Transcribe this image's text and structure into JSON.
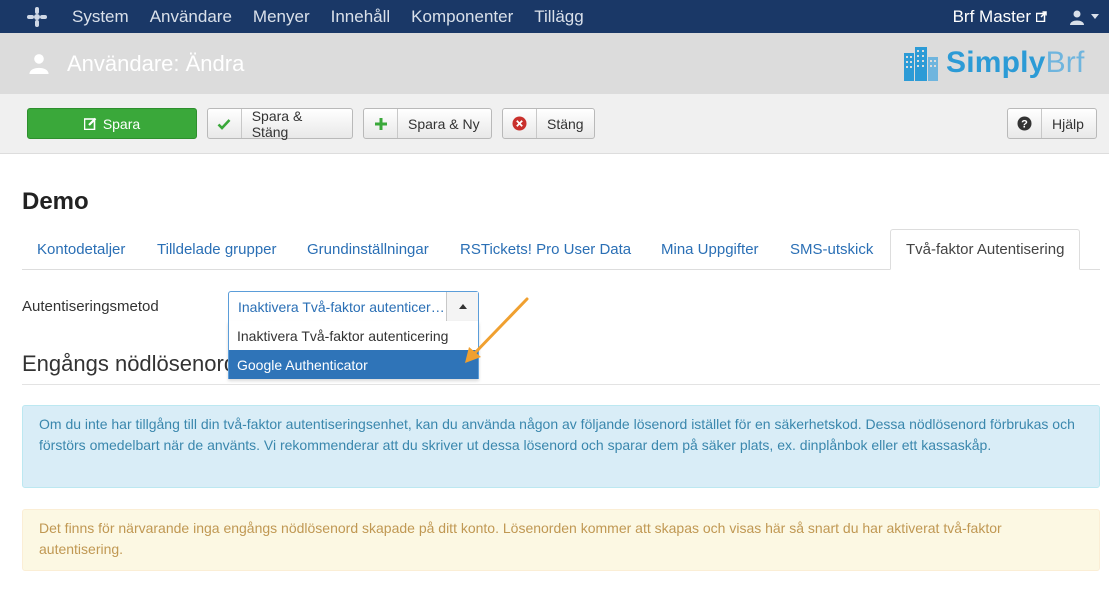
{
  "topnav": {
    "items": [
      "System",
      "Användare",
      "Menyer",
      "Innehåll",
      "Komponenter",
      "Tillägg"
    ],
    "site_name": "Brf Master"
  },
  "header": {
    "title": "Användare: Ändra",
    "brand_part1": "Simply",
    "brand_part2": "Brf"
  },
  "toolbar": {
    "save": "Spara",
    "save_close": "Spara & Stäng",
    "save_new": "Spara & Ny",
    "close": "Stäng",
    "help": "Hjälp"
  },
  "page": {
    "title": "Demo",
    "tabs": [
      "Kontodetaljer",
      "Tilldelade grupper",
      "Grundinställningar",
      "RSTickets! Pro User Data",
      "Mina Uppgifter",
      "SMS-utskick",
      "Två-faktor Autentisering"
    ],
    "active_tab": 6
  },
  "form": {
    "method_label": "Autentiseringsmetod",
    "selected_value": "Inaktivera Två-faktor autenticering",
    "options": [
      "Inaktivera Två-faktor autenticering",
      "Google Authenticator"
    ],
    "highlighted_option": 1
  },
  "section": {
    "title": "Engångs nödlösenord",
    "info_text": "Om du inte har tillgång till din två-faktor autentiseringsenhet, kan du använda någon av följande lösenord istället för en säkerhetskod. Dessa nödlösenord förbrukas och förstörs omedelbart när de använts. Vi rekommenderar att du skriver ut dessa lösenord och sparar dem på säker plats, ex. dinplånbok eller ett kassaskåp.",
    "warning_text": "Det finns för närvarande inga engångs nödlösenord skapade på ditt konto. Lösenorden kommer att skapas och visas här så snart du har aktiverat två-faktor autentisering."
  },
  "colors": {
    "nav_bg": "#1a3867",
    "save_green": "#3aa83a",
    "link_blue": "#2a6fb5",
    "annotation_orange": "#f0a030"
  }
}
